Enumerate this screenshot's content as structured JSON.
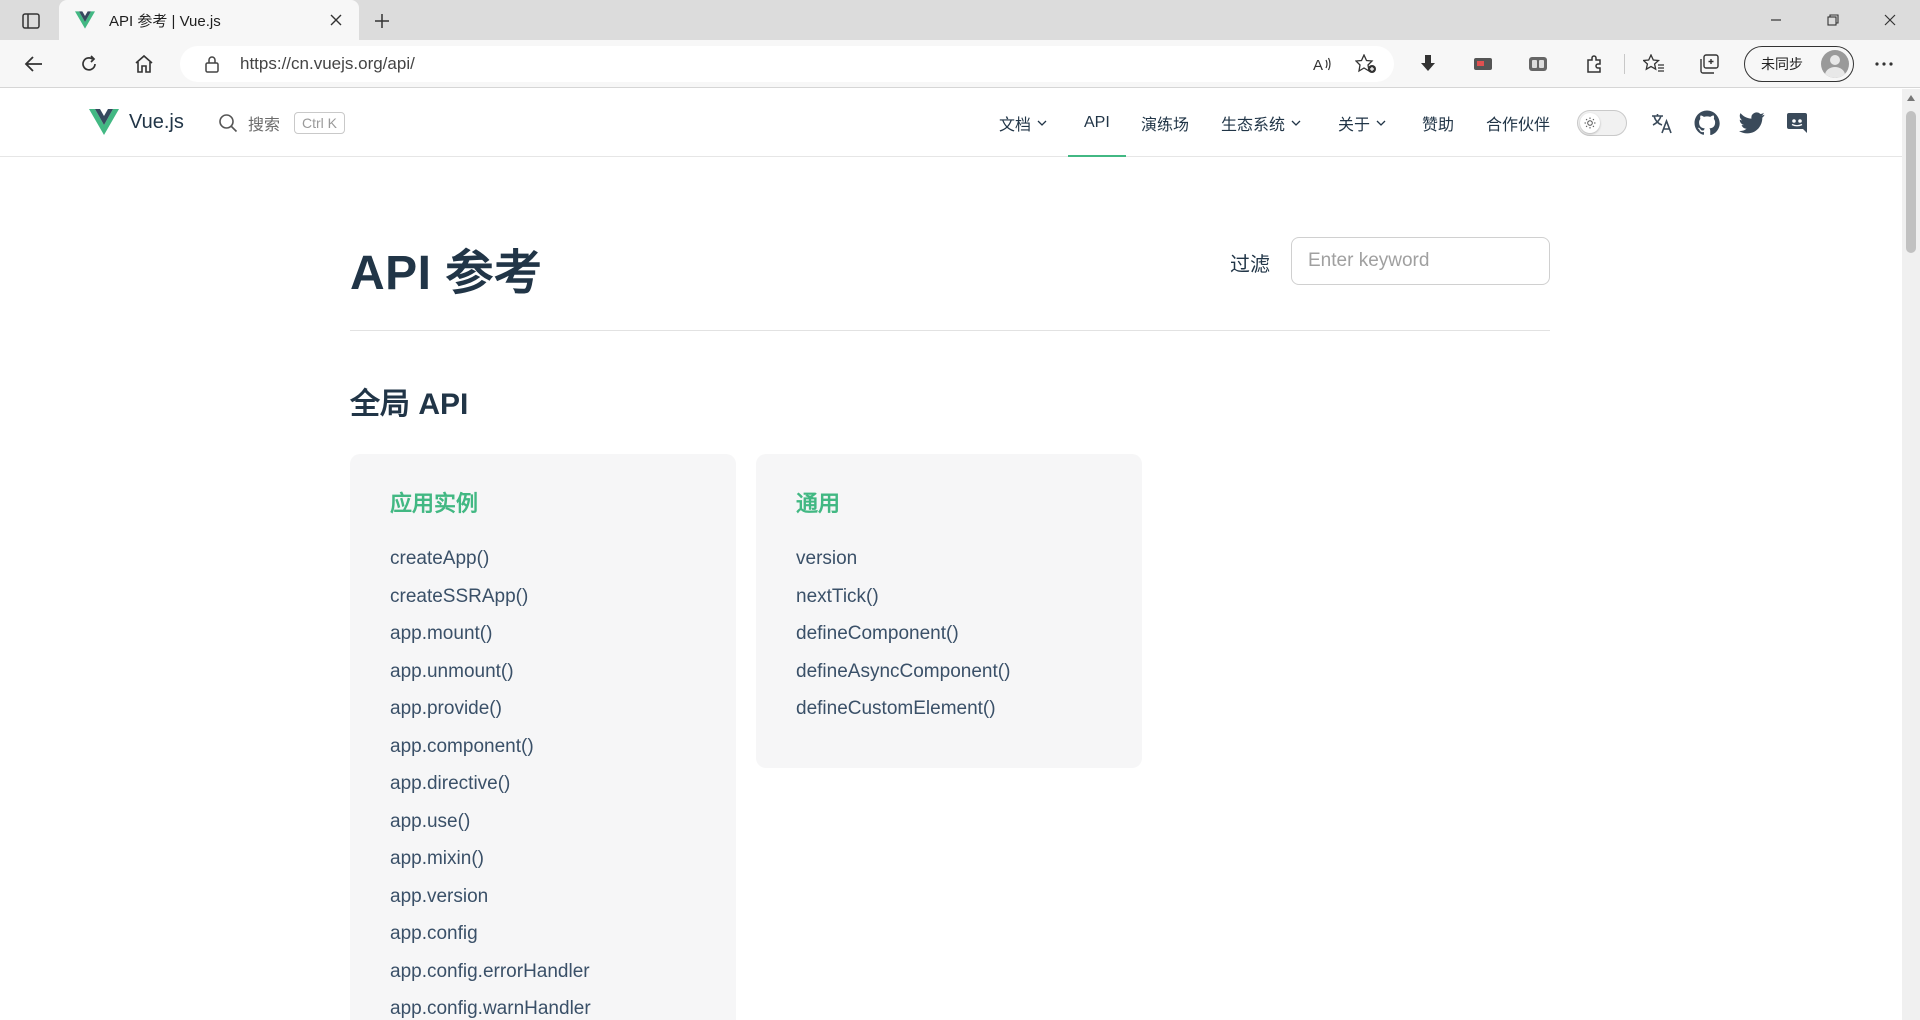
{
  "browser": {
    "tab_title": "API 参考 | Vue.js",
    "url": "https://cn.vuejs.org/api/",
    "profile_label": "未同步",
    "icons": [
      "tab-actions-icon",
      "vue-favicon",
      "close-icon",
      "plus-icon",
      "minimize-icon",
      "restore-icon",
      "close-window-icon",
      "back-icon",
      "refresh-icon",
      "home-icon",
      "lock-icon",
      "read-aloud-icon",
      "add-favorite-icon",
      "download-icon",
      "extension-icon",
      "split-screen-icon",
      "puzzle-icon",
      "favorites-icon",
      "collections-icon",
      "avatar",
      "more-icon"
    ]
  },
  "site": {
    "brand": "Vue.js",
    "search_label": "搜索",
    "search_shortcut": "Ctrl K",
    "nav": {
      "docs": "文档",
      "api": "API",
      "playground": "演练场",
      "ecosystem": "生态系统",
      "about": "关于",
      "sponsor": "赞助",
      "partners": "合作伙伴"
    },
    "accent_color": "#42b883"
  },
  "page": {
    "title": "API 参考",
    "filter_label": "过滤",
    "filter_placeholder": "Enter keyword",
    "section_title": "全局 API",
    "cards": [
      {
        "title": "应用实例",
        "items": [
          "createApp()",
          "createSSRApp()",
          "app.mount()",
          "app.unmount()",
          "app.provide()",
          "app.component()",
          "app.directive()",
          "app.use()",
          "app.mixin()",
          "app.version",
          "app.config",
          "app.config.errorHandler",
          "app.config.warnHandler"
        ]
      },
      {
        "title": "通用",
        "items": [
          "version",
          "nextTick()",
          "defineComponent()",
          "defineAsyncComponent()",
          "defineCustomElement()"
        ]
      }
    ]
  }
}
